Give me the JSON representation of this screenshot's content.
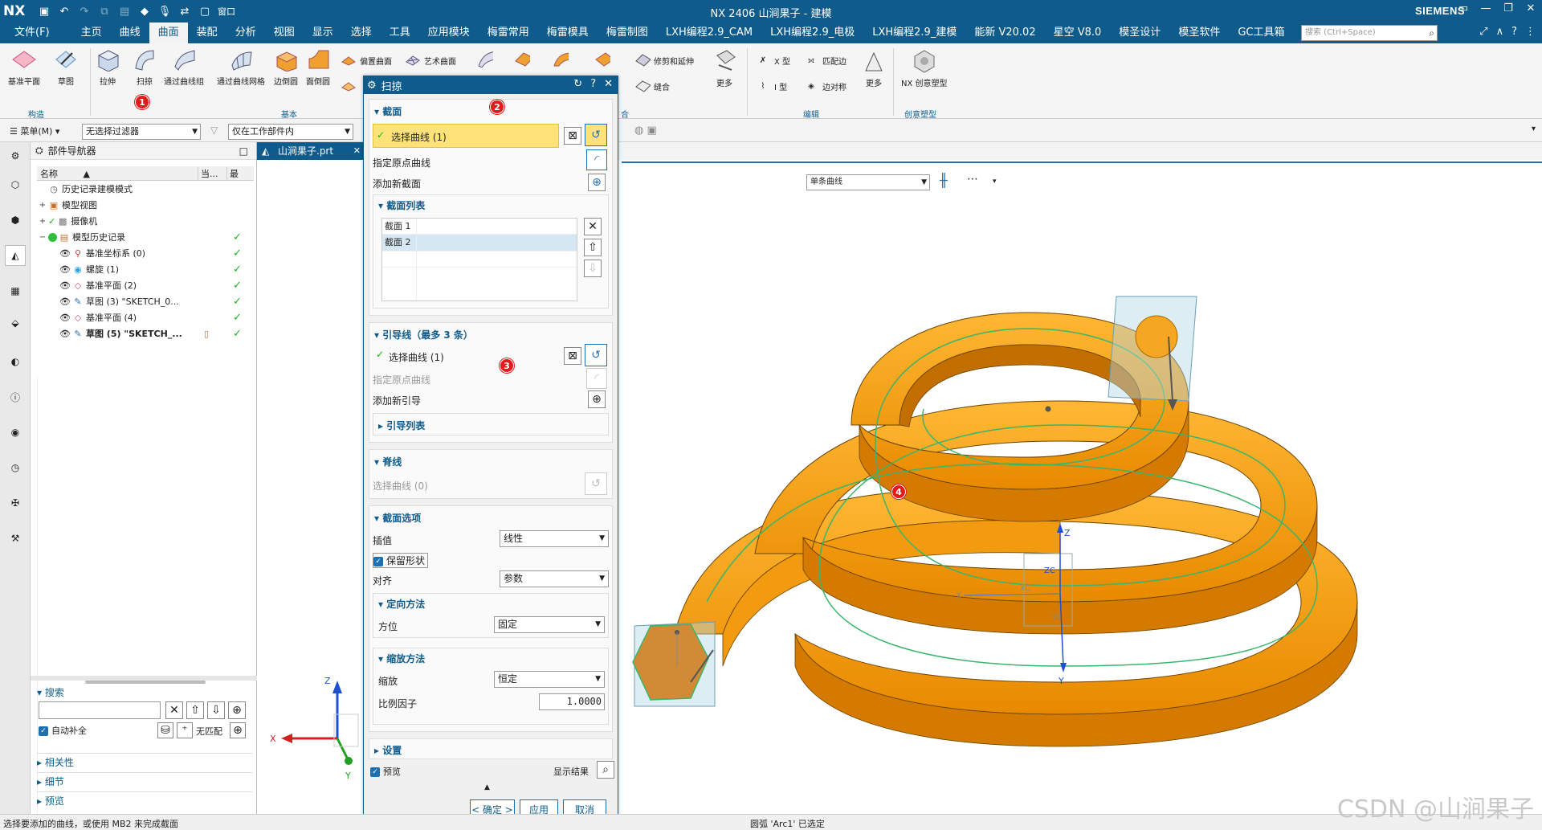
{
  "app": {
    "logo": "NX",
    "window_title": "NX 2406 山涧果子 - 建模",
    "brand": "SIEMENS",
    "window_buttons": [
      "▭",
      "—",
      "❐",
      "✕"
    ]
  },
  "quick_access": [
    "save-icon",
    "undo-icon",
    "redo-icon",
    "copy-icon",
    "paste-icon",
    "command-finder-icon",
    "mic-icon",
    "swap-icon",
    "window-icon"
  ],
  "quick_window_label": "窗口",
  "menu": {
    "file": "文件(F)",
    "items": [
      "主页",
      "曲线",
      "曲面",
      "装配",
      "分析",
      "视图",
      "显示",
      "选择",
      "工具",
      "应用模块",
      "梅雷常用",
      "梅雷模具",
      "梅雷制图",
      "LXH编程2.9_CAM",
      "LXH编程2.9_电极",
      "LXH编程2.9_建模",
      "能新 V20.02",
      "星空 V8.0",
      "模圣设计",
      "模圣软件",
      "GC工具箱"
    ],
    "active_index": 2,
    "search_placeholder": "搜索 (Ctrl+Space)"
  },
  "ribbon": {
    "construct": {
      "datum_plane": "基准平面",
      "sketch": "草图",
      "group": "构造"
    },
    "basic": {
      "extrude": "拉伸",
      "sweep": "扫掠",
      "through_curve_group": "通过曲线组",
      "through_curve_mesh": "通过曲线网格",
      "bounded_plane": "边倒圆",
      "face_blend": "面倒圆",
      "offset_surface": "偏置曲面",
      "studio_surface": "艺术曲面",
      "group": "基本"
    },
    "trim_extend": "修剪和延伸",
    "combine": "缝合",
    "more1": "更多",
    "edit": {
      "x_type": "X 型",
      "match_edge": "匹配边",
      "i_type": "I 型",
      "edge_symmetry": "边对称",
      "more": "更多",
      "group": "编辑"
    },
    "creative": {
      "nx_creative": "NX 创意塑型",
      "group": "创意塑型"
    },
    "group_fragment": "合"
  },
  "selection_bar": {
    "menu": "菜单(M)",
    "filter": "无选择过滤器",
    "scope": "仅在工作部件内"
  },
  "navigator": {
    "title": "部件导航器",
    "columns": [
      "名称",
      "当...",
      "最"
    ],
    "rows": [
      {
        "label": "历史记录建模模式",
        "icon": "clock-icon",
        "indent": 0,
        "check": false
      },
      {
        "label": "模型视图",
        "icon": "model-view-icon",
        "indent": 0,
        "check": false,
        "toggle": "+"
      },
      {
        "label": "摄像机",
        "icon": "camera-icon",
        "indent": 0,
        "check": false,
        "toggle": "+"
      },
      {
        "label": "模型历史记录",
        "icon": "history-icon",
        "indent": 0,
        "check": true,
        "toggle": "−"
      },
      {
        "label": "基准坐标系 (0)",
        "icon": "csys-icon",
        "indent": 1,
        "check": true
      },
      {
        "label": "螺旋 (1)",
        "icon": "helix-icon",
        "indent": 1,
        "check": true
      },
      {
        "label": "基准平面 (2)",
        "icon": "plane-icon",
        "indent": 1,
        "check": true
      },
      {
        "label": "草图 (3) \"SKETCH_0...",
        "icon": "sketch-icon",
        "indent": 1,
        "check": true
      },
      {
        "label": "基准平面 (4)",
        "icon": "plane-icon",
        "indent": 1,
        "check": true
      },
      {
        "label": "草图 (5) \"SKETCH_...",
        "icon": "sketch-icon",
        "indent": 1,
        "check": true,
        "bold": true
      }
    ],
    "search": {
      "title": "搜索",
      "auto_complete": "自动补全",
      "no_match": "无匹配"
    },
    "sections": [
      "相关性",
      "细节",
      "预览"
    ]
  },
  "part_tab": "山涧果子.prt",
  "graphics": {
    "curve_rule": "单条曲线"
  },
  "dialog": {
    "title": "扫掠",
    "section": {
      "title": "截面",
      "select_curve": "选择曲线 (1)",
      "specify_origin": "指定原点曲线",
      "add_new": "添加新截面",
      "list_title": "截面列表",
      "list": [
        "截面 1",
        "截面 2"
      ]
    },
    "guide": {
      "title": "引导线（最多 3 条）",
      "select_curve": "选择曲线 (1)",
      "specify_origin": "指定原点曲线",
      "add_new": "添加新引导",
      "list_title": "引导列表"
    },
    "spine": {
      "title": "脊线",
      "select_curve": "选择曲线 (0)"
    },
    "options": {
      "title": "截面选项",
      "interpolation_label": "插值",
      "interpolation_value": "线性",
      "preserve_shape": "保留形状",
      "alignment_label": "对齐",
      "alignment_value": "参数",
      "orientation_title": "定向方法",
      "orientation_label": "方位",
      "orientation_value": "固定",
      "scaling_title": "缩放方法",
      "scaling_label": "缩放",
      "scaling_value": "恒定",
      "scale_factor_label": "比例因子",
      "scale_factor_value": "1.0000"
    },
    "settings": "设置",
    "preview": "预览",
    "show_result": "显示结果",
    "ok": "< 确定 >",
    "apply": "应用",
    "cancel": "取消"
  },
  "callouts": [
    "1",
    "2",
    "3",
    "4"
  ],
  "axes": {
    "x": "X",
    "y": "Y",
    "z": "Z",
    "zc": "ZC",
    "xc": "XC",
    "yc": "YC"
  },
  "status": {
    "left": "选择要添加的曲线，或使用 MB2 来完成截面",
    "center": "圆弧 'Arc1' 已选定"
  },
  "watermark": "CSDN @山涧果子",
  "colors": {
    "brand_blue": "#0f5c8c",
    "model_orange": "#f5a623",
    "callout_red": "#e31b1b",
    "check_green": "#18b418"
  }
}
